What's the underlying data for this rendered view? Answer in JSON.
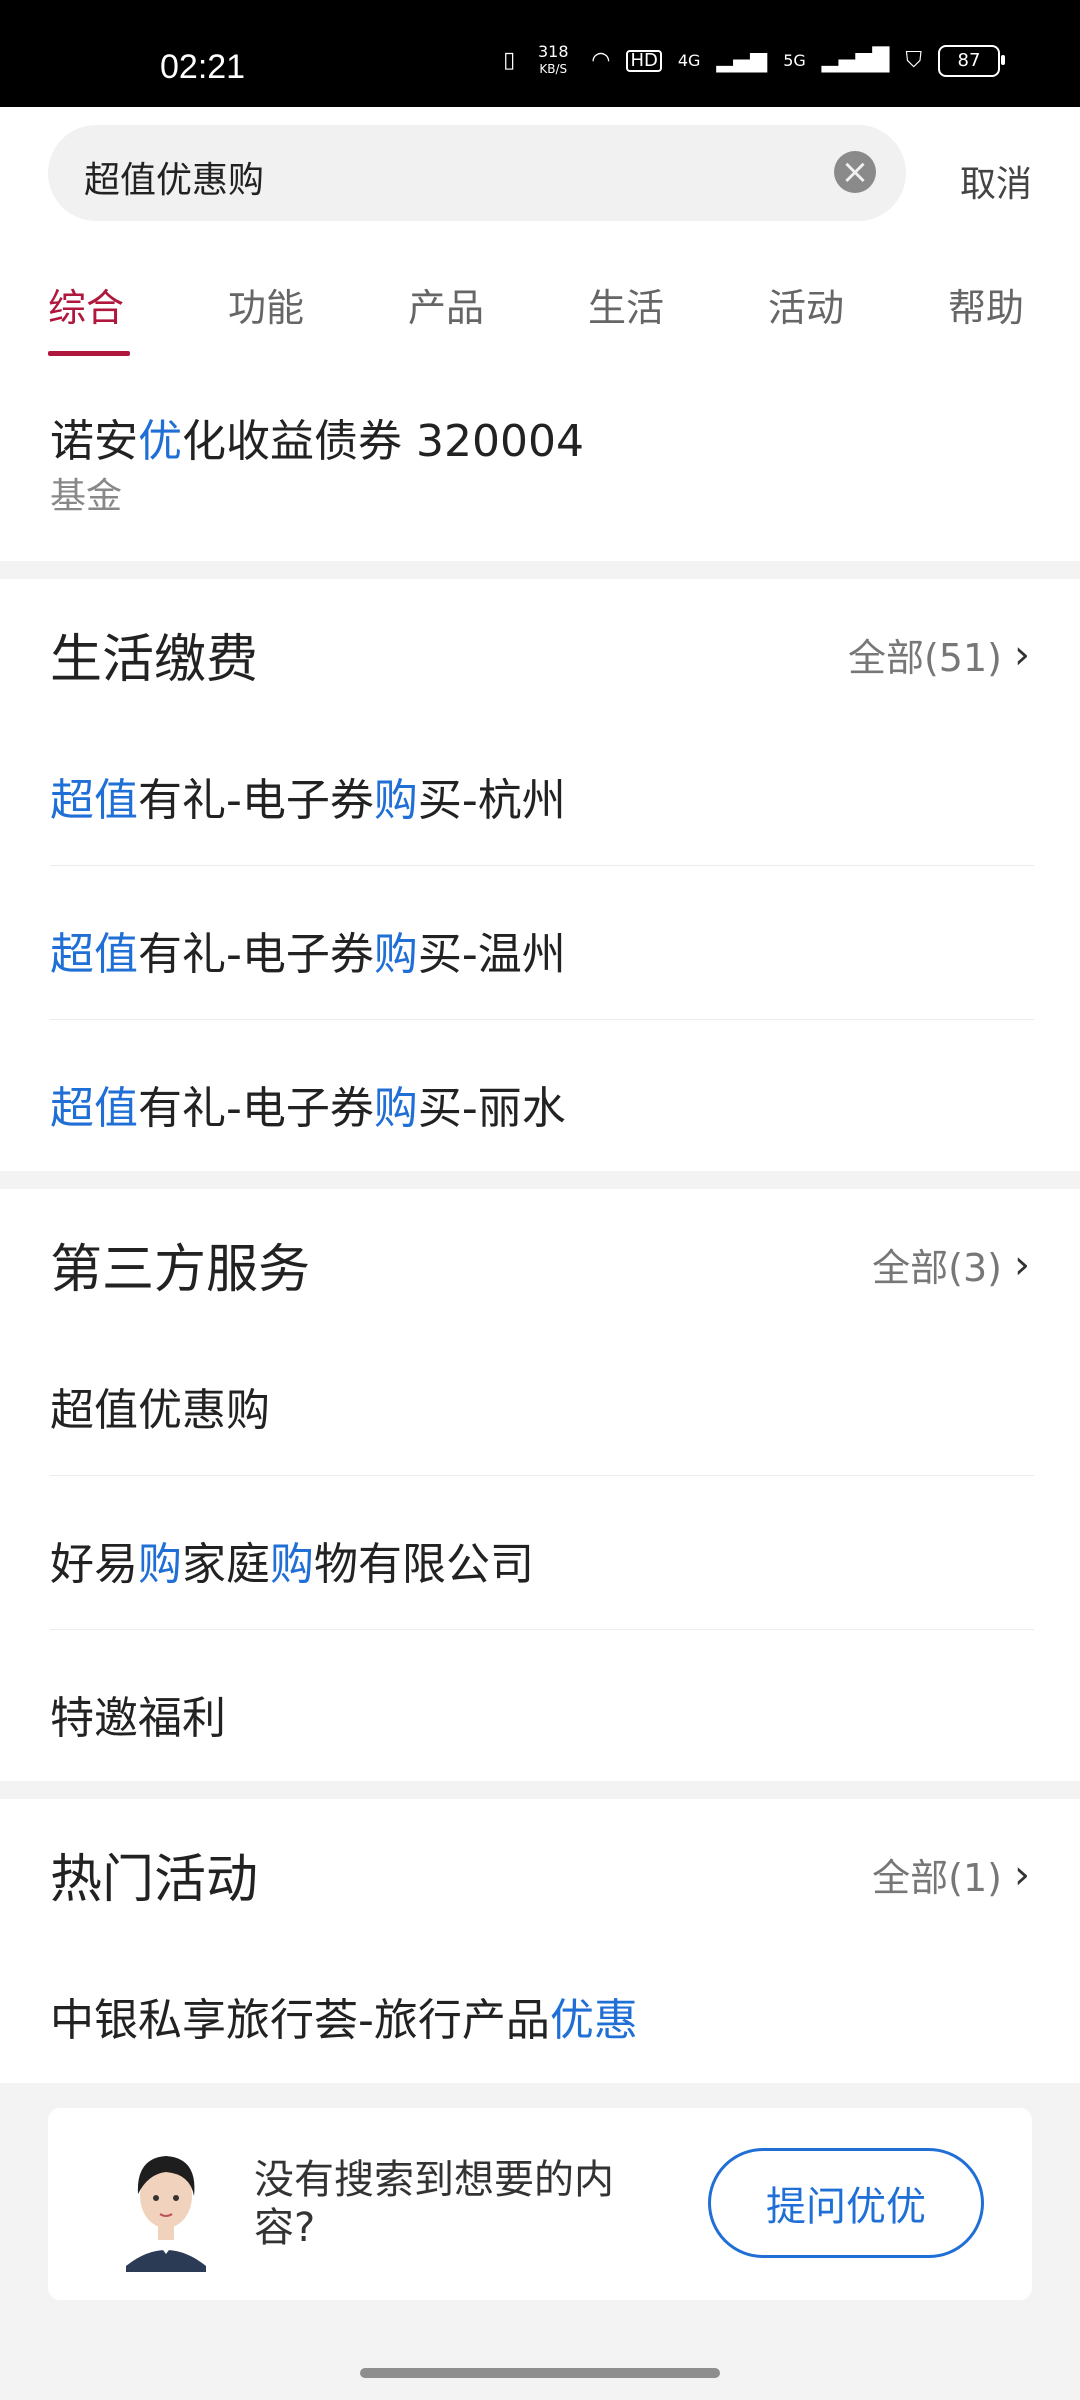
{
  "status_bar": {
    "time": "02:21",
    "net_speed_top": "318",
    "net_speed_bottom": "KB/S",
    "hd": "HD",
    "net_4g": "4G",
    "net_5g": "5G",
    "battery": "87"
  },
  "search": {
    "query": "超值优惠购",
    "cancel_label": "取消"
  },
  "tabs": [
    {
      "label": "综合",
      "active": true
    },
    {
      "label": "功能"
    },
    {
      "label": "产品"
    },
    {
      "label": "生活"
    },
    {
      "label": "活动"
    },
    {
      "label": "帮助"
    }
  ],
  "fund_result": {
    "name_pre": "诺安",
    "name_hl": "优",
    "name_post": "化收益债券 320004",
    "category": "基金"
  },
  "life_payment": {
    "title": "生活缴费",
    "all_label": "全部(51)",
    "items": [
      {
        "hl1": "超值",
        "mid": "有礼-电子券",
        "hl2": "购",
        "end": "买-杭州"
      },
      {
        "hl1": "超值",
        "mid": "有礼-电子券",
        "hl2": "购",
        "end": "买-温州"
      },
      {
        "hl1": "超值",
        "mid": "有礼-电子券",
        "hl2": "购",
        "end": "买-丽水"
      }
    ]
  },
  "third_party": {
    "title": "第三方服务",
    "all_label": "全部(3)",
    "item1": "超值优惠购",
    "item2": {
      "a": "好易",
      "b": "购",
      "c": "家庭",
      "d": "购",
      "e": "物有限公司"
    },
    "item3": "特邀福利"
  },
  "hot_activity": {
    "title": "热门活动",
    "all_label": "全部(1)",
    "item_pre": "中银私享旅行荟-旅行产品",
    "item_hl": "优惠"
  },
  "help": {
    "text": "没有搜索到想要的内容?",
    "button_label": "提问优优"
  },
  "colors": {
    "accent_red": "#b0173d",
    "highlight_blue": "#1f6fd6"
  }
}
